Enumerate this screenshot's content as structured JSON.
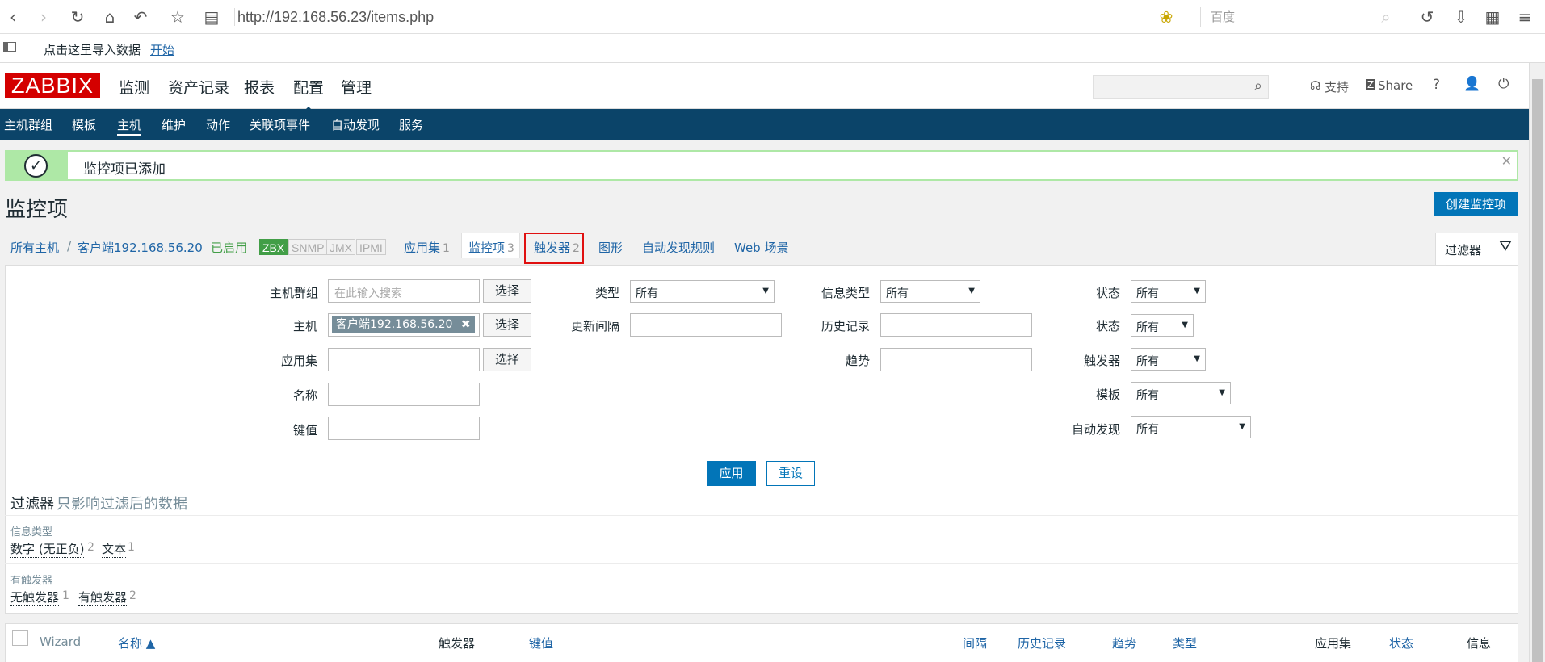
{
  "browser": {
    "url": "http://192.168.56.23/items.php",
    "search_placeholder": "百度",
    "bookmark_text": "点击这里导入数据",
    "bookmark_link": "开始"
  },
  "header": {
    "logo": "ZABBIX",
    "menu": [
      "监测",
      "资产记录",
      "报表",
      "配置",
      "管理"
    ],
    "support": "支持",
    "share": "Share",
    "help": "?"
  },
  "subnav": [
    "主机群组",
    "模板",
    "主机",
    "维护",
    "动作",
    "关联项事件",
    "自动发现",
    "服务"
  ],
  "message": "监控项已添加",
  "page": {
    "title": "监控项",
    "create_button": "创建监控项"
  },
  "breadcrumb": {
    "all_hosts": "所有主机",
    "separator": "/",
    "host": "客户端192.168.56.20",
    "enabled": "已启用",
    "zbx": "ZBX",
    "snmp": "SNMP",
    "jmx": "JMX",
    "ipmi": "IPMI",
    "app_label": "应用集",
    "app_count": "1",
    "items_label": "监控项",
    "items_count": "3",
    "triggers_label": "触发器",
    "triggers_count": "2",
    "graphs": "图形",
    "discovery": "自动发现规则",
    "web": "Web 场景",
    "filter_tab": "过滤器"
  },
  "filter": {
    "hostgroup_label": "主机群组",
    "hostgroup_placeholder": "在此输入搜索",
    "select": "选择",
    "host_label": "主机",
    "host_value": "客户端192.168.56.20",
    "app_label": "应用集",
    "name_label": "名称",
    "key_label": "键值",
    "type_label": "类型",
    "type_value": "所有",
    "interval_label": "更新间隔",
    "infotype_label": "信息类型",
    "infotype_value": "所有",
    "history_label": "历史记录",
    "trends_label": "趋势",
    "state_label": "状态",
    "state_value": "所有",
    "status_label": "状态",
    "status_value": "所有",
    "triggers_label": "触发器",
    "triggers_value": "所有",
    "template_label": "模板",
    "template_value": "所有",
    "discovery_label": "自动发现",
    "discovery_value": "所有",
    "apply": "应用",
    "reset": "重设"
  },
  "subfilter": {
    "title": "过滤器",
    "hint": "只影响过滤后的数据",
    "infotype_label": "信息类型",
    "numeric": "数字 (无正负)",
    "numeric_count": "2",
    "text": "文本",
    "text_count": "1",
    "hastriggers_label": "有触发器",
    "no_triggers": "无触发器",
    "no_triggers_count": "1",
    "with_triggers": "有触发器",
    "with_triggers_count": "2"
  },
  "table": {
    "wizard": "Wizard",
    "name": "名称 ▲",
    "triggers": "触发器",
    "key": "键值",
    "interval": "间隔",
    "history": "历史记录",
    "trends": "趋势",
    "type": "类型",
    "applications": "应用集",
    "status": "状态",
    "info": "信息"
  }
}
